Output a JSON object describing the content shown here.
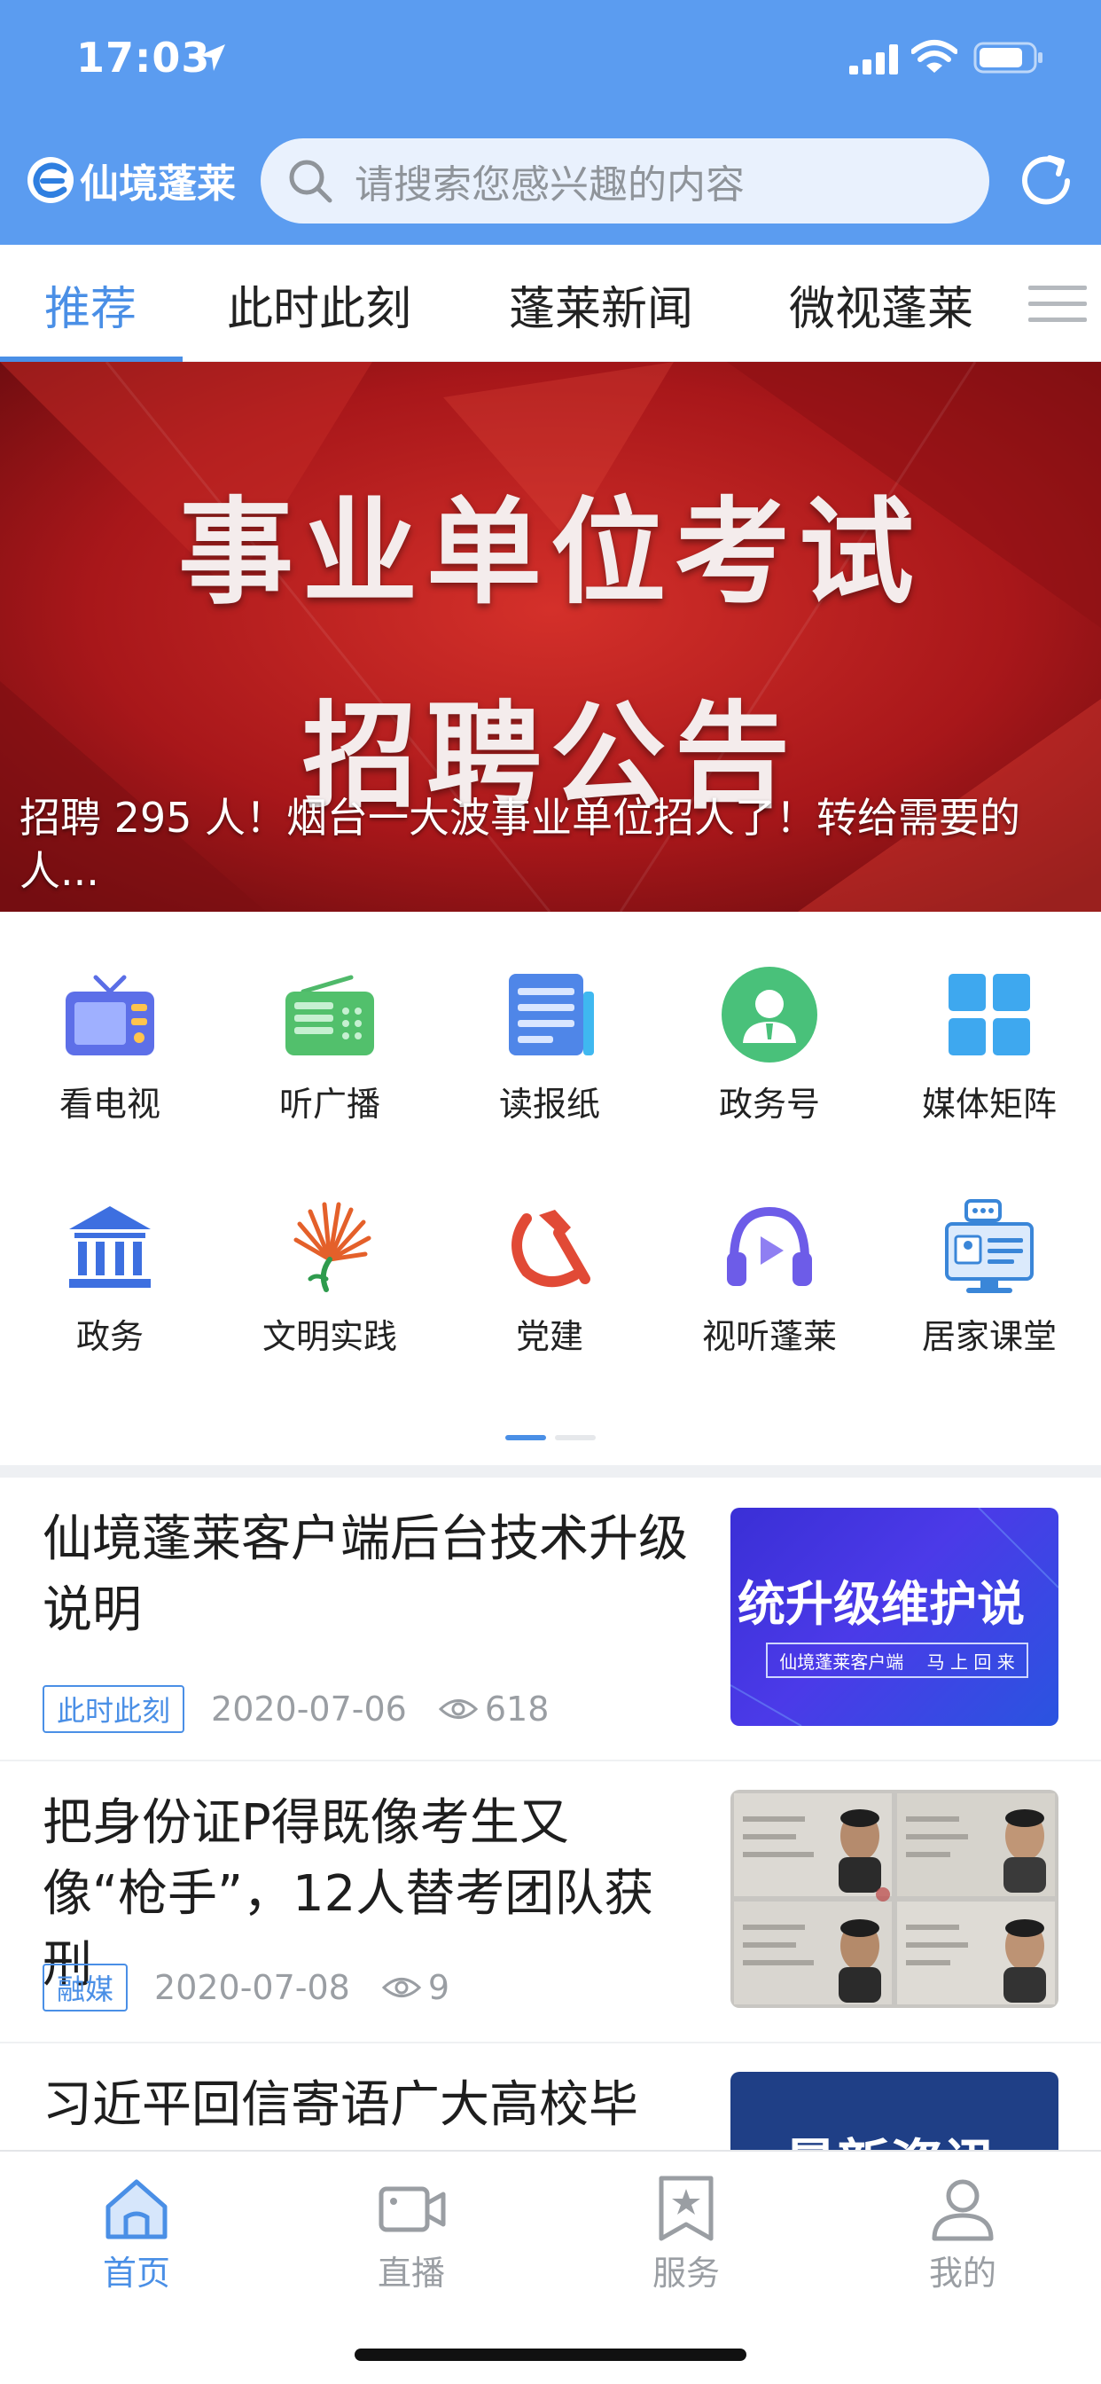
{
  "status_bar": {
    "time": "17:03"
  },
  "header": {
    "app_name": "仙境蓬莱",
    "search_placeholder": "请搜索您感兴趣的内容"
  },
  "tabs": [
    {
      "label": "推荐",
      "active": true
    },
    {
      "label": "此时此刻"
    },
    {
      "label": "蓬莱新闻"
    },
    {
      "label": "微视蓬莱"
    }
  ],
  "banner": {
    "headline": "事业单位考试",
    "subheadline": "招聘公告",
    "caption": "招聘 295 人！烟台一大波事业单位招人了！转给需要的人..."
  },
  "grid": [
    {
      "label": "看电视",
      "icon": "tv-icon"
    },
    {
      "label": "听广播",
      "icon": "radio-icon"
    },
    {
      "label": "读报纸",
      "icon": "newspaper-icon"
    },
    {
      "label": "政务号",
      "icon": "official-account-icon"
    },
    {
      "label": "媒体矩阵",
      "icon": "grid-matrix-icon"
    },
    {
      "label": "政务",
      "icon": "government-building-icon"
    },
    {
      "label": "文明实践",
      "icon": "fan-flower-icon"
    },
    {
      "label": "党建",
      "icon": "hammer-sickle-icon"
    },
    {
      "label": "视听蓬莱",
      "icon": "headphones-play-icon"
    },
    {
      "label": "居家课堂",
      "icon": "online-class-icon"
    }
  ],
  "news": [
    {
      "title": "仙境蓬莱客户端后台技术升级说明",
      "tag": "此时此刻",
      "date": "2020-07-06",
      "views": "618",
      "thumb_text": "统升级维护说",
      "thumb_sub_left": "仙境蓬莱客户端",
      "thumb_sub_right": "马 上 回 来"
    },
    {
      "title": "把身份证P得既像考生又像“枪手”，12人替考团队获刑",
      "tag": "融媒",
      "date": "2020-07-08",
      "views": "9"
    },
    {
      "title": "习近平回信寄语广大高校毕",
      "thumb_text": "最新资讯"
    }
  ],
  "bottom_nav": [
    {
      "label": "首页",
      "active": true
    },
    {
      "label": "直播"
    },
    {
      "label": "服务"
    },
    {
      "label": "我的"
    }
  ],
  "colors": {
    "header_bg": "#5b9cf0",
    "accent": "#4a8fe6"
  }
}
